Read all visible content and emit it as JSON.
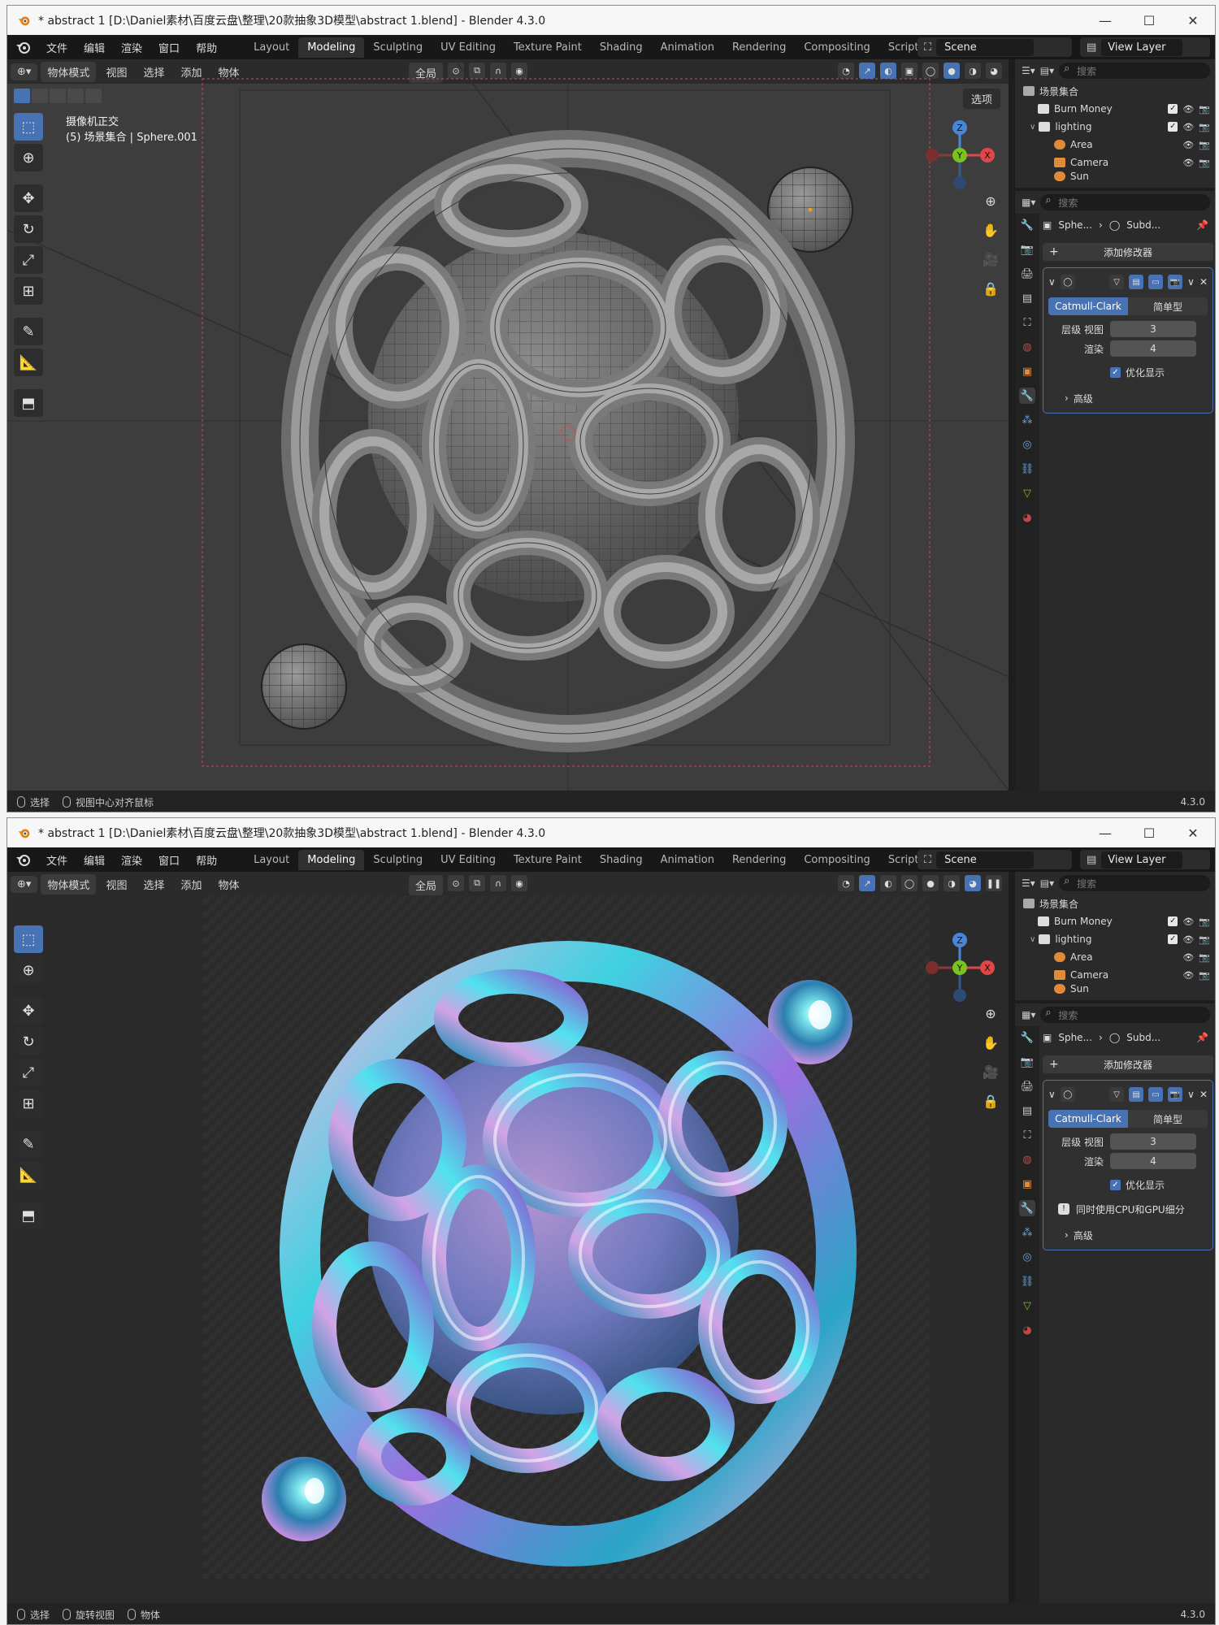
{
  "window_title": "* abstract 1 [D:\\Daniel素材\\百度云盘\\整理\\20款抽象3D模型\\abstract 1.blend] - Blender 4.3.0",
  "menus": [
    "文件",
    "编辑",
    "渲染",
    "窗口",
    "帮助"
  ],
  "workspaces": [
    "Layout",
    "Modeling",
    "Sculpting",
    "UV Editing",
    "Texture Paint",
    "Shading",
    "Animation",
    "Rendering",
    "Compositing",
    "Scripting"
  ],
  "active_workspace": "Modeling",
  "scene_name": "Scene",
  "view_layer": "View Layer",
  "viewport_header": {
    "mode": "物体模式",
    "view": "视图",
    "select": "选择",
    "add": "添加",
    "object": "物体",
    "orientation": "全局",
    "options": "选项"
  },
  "viewport_info": {
    "line1": "摄像机正交",
    "line2": "(5) 场景集合 | Sphere.001"
  },
  "outliner": {
    "search_placeholder": "搜索",
    "root": "场景集合",
    "items": [
      {
        "name": "Burn Money",
        "indent": 1
      },
      {
        "name": "lighting",
        "indent": 1
      },
      {
        "name": "Area",
        "indent": 2
      },
      {
        "name": "Camera",
        "indent": 2
      },
      {
        "name": "Sun",
        "indent": 2
      }
    ]
  },
  "properties": {
    "search_placeholder": "搜索",
    "breadcrumb_object": "Sphe...",
    "breadcrumb_modifier": "Subd...",
    "add_modifier": "添加修改器",
    "subdiv_type_a": "Catmull-Clark",
    "subdiv_type_b": "简单型",
    "levels_label": "层级 视图",
    "levels_value": "3",
    "render_label": "渲染",
    "render_value": "4",
    "optimize_label": "优化显示",
    "warning": "同时使用CPU和GPU细分",
    "advanced": "高级"
  },
  "statusbar_top": {
    "select": "选择",
    "action": "视图中心对齐鼠标",
    "version": "4.3.0"
  },
  "statusbar_bottom": {
    "select": "选择",
    "action": "旋转视图",
    "object": "物体",
    "version": "4.3.0"
  },
  "gizmo_axes": {
    "z": "Z",
    "y": "Y",
    "x": "X"
  },
  "colors": {
    "accent": "#4772b3",
    "x_axis": "#e04848",
    "y_axis": "#7ac21d",
    "z_axis": "#4a86d8"
  }
}
